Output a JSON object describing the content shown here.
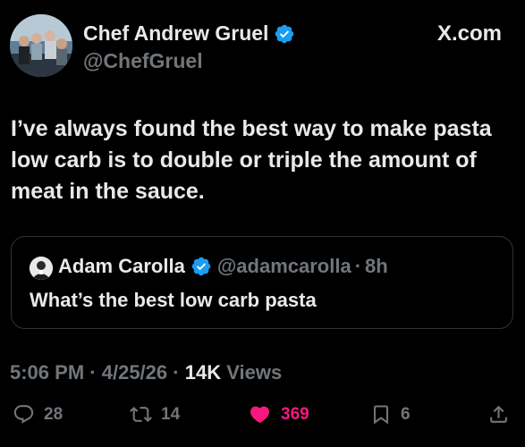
{
  "author": {
    "display_name": "Chef Andrew Gruel",
    "handle": "@ChefGruel",
    "verified": true,
    "verified_color": "#1d9bf0"
  },
  "source_label": "X.com",
  "tweet": {
    "text": "I’ve always found the best way to make pasta low carb is to double or triple the amount of meat in the sauce."
  },
  "quoted": {
    "display_name": "Adam Carolla",
    "handle": "@adamcarolla",
    "separator": "·",
    "time": "8h",
    "text": "What’s the best low carb pasta"
  },
  "meta": {
    "time": "5:06 PM",
    "sep1": "·",
    "date": "4/25/26",
    "sep2": "·",
    "views_count": "14K",
    "views_label": "Views"
  },
  "actions": {
    "replies": "28",
    "reposts": "14",
    "likes": "369",
    "bookmarks": "6",
    "like_color": "#f91880",
    "muted_color": "#71767b"
  },
  "icons": [
    "verified-badge-icon",
    "reply-icon",
    "repost-icon",
    "heart-icon",
    "bookmark-icon",
    "share-icon"
  ]
}
